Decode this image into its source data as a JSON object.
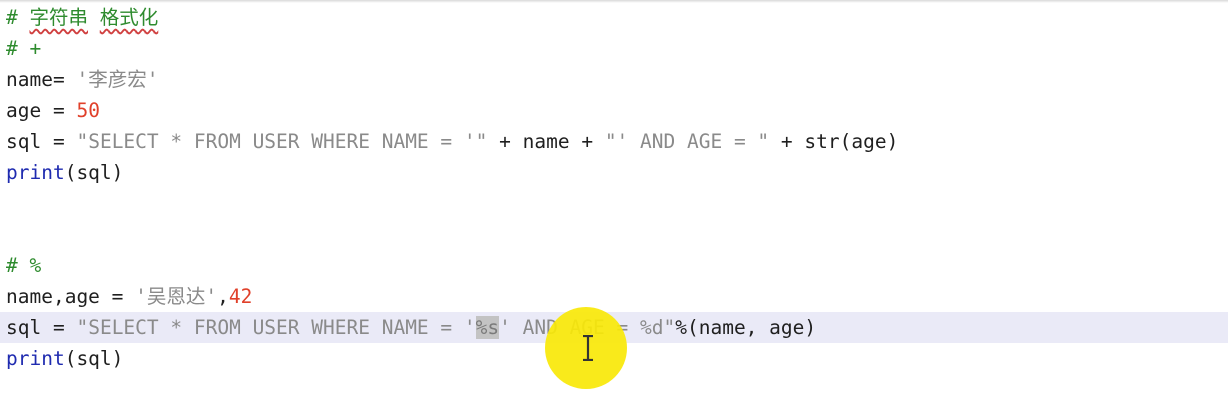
{
  "editor": {
    "lines": [
      {
        "tokens": [
          {
            "t": "# ",
            "c": "comment"
          },
          {
            "t": "字符串",
            "c": "comment-cjk"
          },
          {
            "t": " ",
            "c": "comment"
          },
          {
            "t": "格式化",
            "c": "comment-cjk"
          }
        ]
      },
      {
        "tokens": [
          {
            "t": "# +",
            "c": "comment"
          }
        ]
      },
      {
        "tokens": [
          {
            "t": "name",
            "c": "plain"
          },
          {
            "t": "=",
            "c": "op"
          },
          {
            "t": " ",
            "c": "plain"
          },
          {
            "t": "'李彦宏'",
            "c": "str"
          }
        ]
      },
      {
        "tokens": [
          {
            "t": "age",
            "c": "plain"
          },
          {
            "t": " = ",
            "c": "op"
          },
          {
            "t": "50",
            "c": "num"
          }
        ]
      },
      {
        "tokens": [
          {
            "t": "sql",
            "c": "plain"
          },
          {
            "t": " = ",
            "c": "op"
          },
          {
            "t": "\"SELECT * FROM USER WHERE NAME = '\"",
            "c": "str"
          },
          {
            "t": " + ",
            "c": "op"
          },
          {
            "t": "name",
            "c": "plain"
          },
          {
            "t": " + ",
            "c": "op"
          },
          {
            "t": "\"' AND AGE = \"",
            "c": "str"
          },
          {
            "t": " + ",
            "c": "op"
          },
          {
            "t": "str",
            "c": "plain"
          },
          {
            "t": "(age)",
            "c": "plain"
          }
        ]
      },
      {
        "tokens": [
          {
            "t": "print",
            "c": "kw"
          },
          {
            "t": "(sql)",
            "c": "plain"
          }
        ]
      },
      {
        "tokens": []
      },
      {
        "tokens": []
      },
      {
        "tokens": [
          {
            "t": "# %",
            "c": "comment"
          }
        ]
      },
      {
        "tokens": [
          {
            "t": "name,age",
            "c": "plain"
          },
          {
            "t": " = ",
            "c": "op"
          },
          {
            "t": "'吴恩达'",
            "c": "str"
          },
          {
            "t": ",",
            "c": "plain"
          },
          {
            "t": "42",
            "c": "num"
          }
        ]
      },
      {
        "current": true,
        "tokens": [
          {
            "t": "sql",
            "c": "plain"
          },
          {
            "t": " = ",
            "c": "op"
          },
          {
            "t": "\"SELECT * FROM USER WHERE NAME = '",
            "c": "str"
          },
          {
            "t": "%s",
            "c": "sel"
          },
          {
            "t": "' AND AGE = %d\"",
            "c": "str"
          },
          {
            "t": "%",
            "c": "op"
          },
          {
            "t": "(name, age)",
            "c": "plain"
          }
        ]
      },
      {
        "tokens": [
          {
            "t": "print",
            "c": "kw"
          },
          {
            "t": "(sql)",
            "c": "plain"
          }
        ]
      }
    ]
  },
  "cursor": {
    "icon": "text-cursor-ibeam-icon",
    "highlight_color": "#f8e808"
  },
  "colors": {
    "comment": "#2e8b2e",
    "string": "#8a8a8a",
    "number": "#e0402a",
    "keyword": "#1f2bb0",
    "current_line": "#eaeaf7",
    "selection": "#c3c3c3"
  }
}
